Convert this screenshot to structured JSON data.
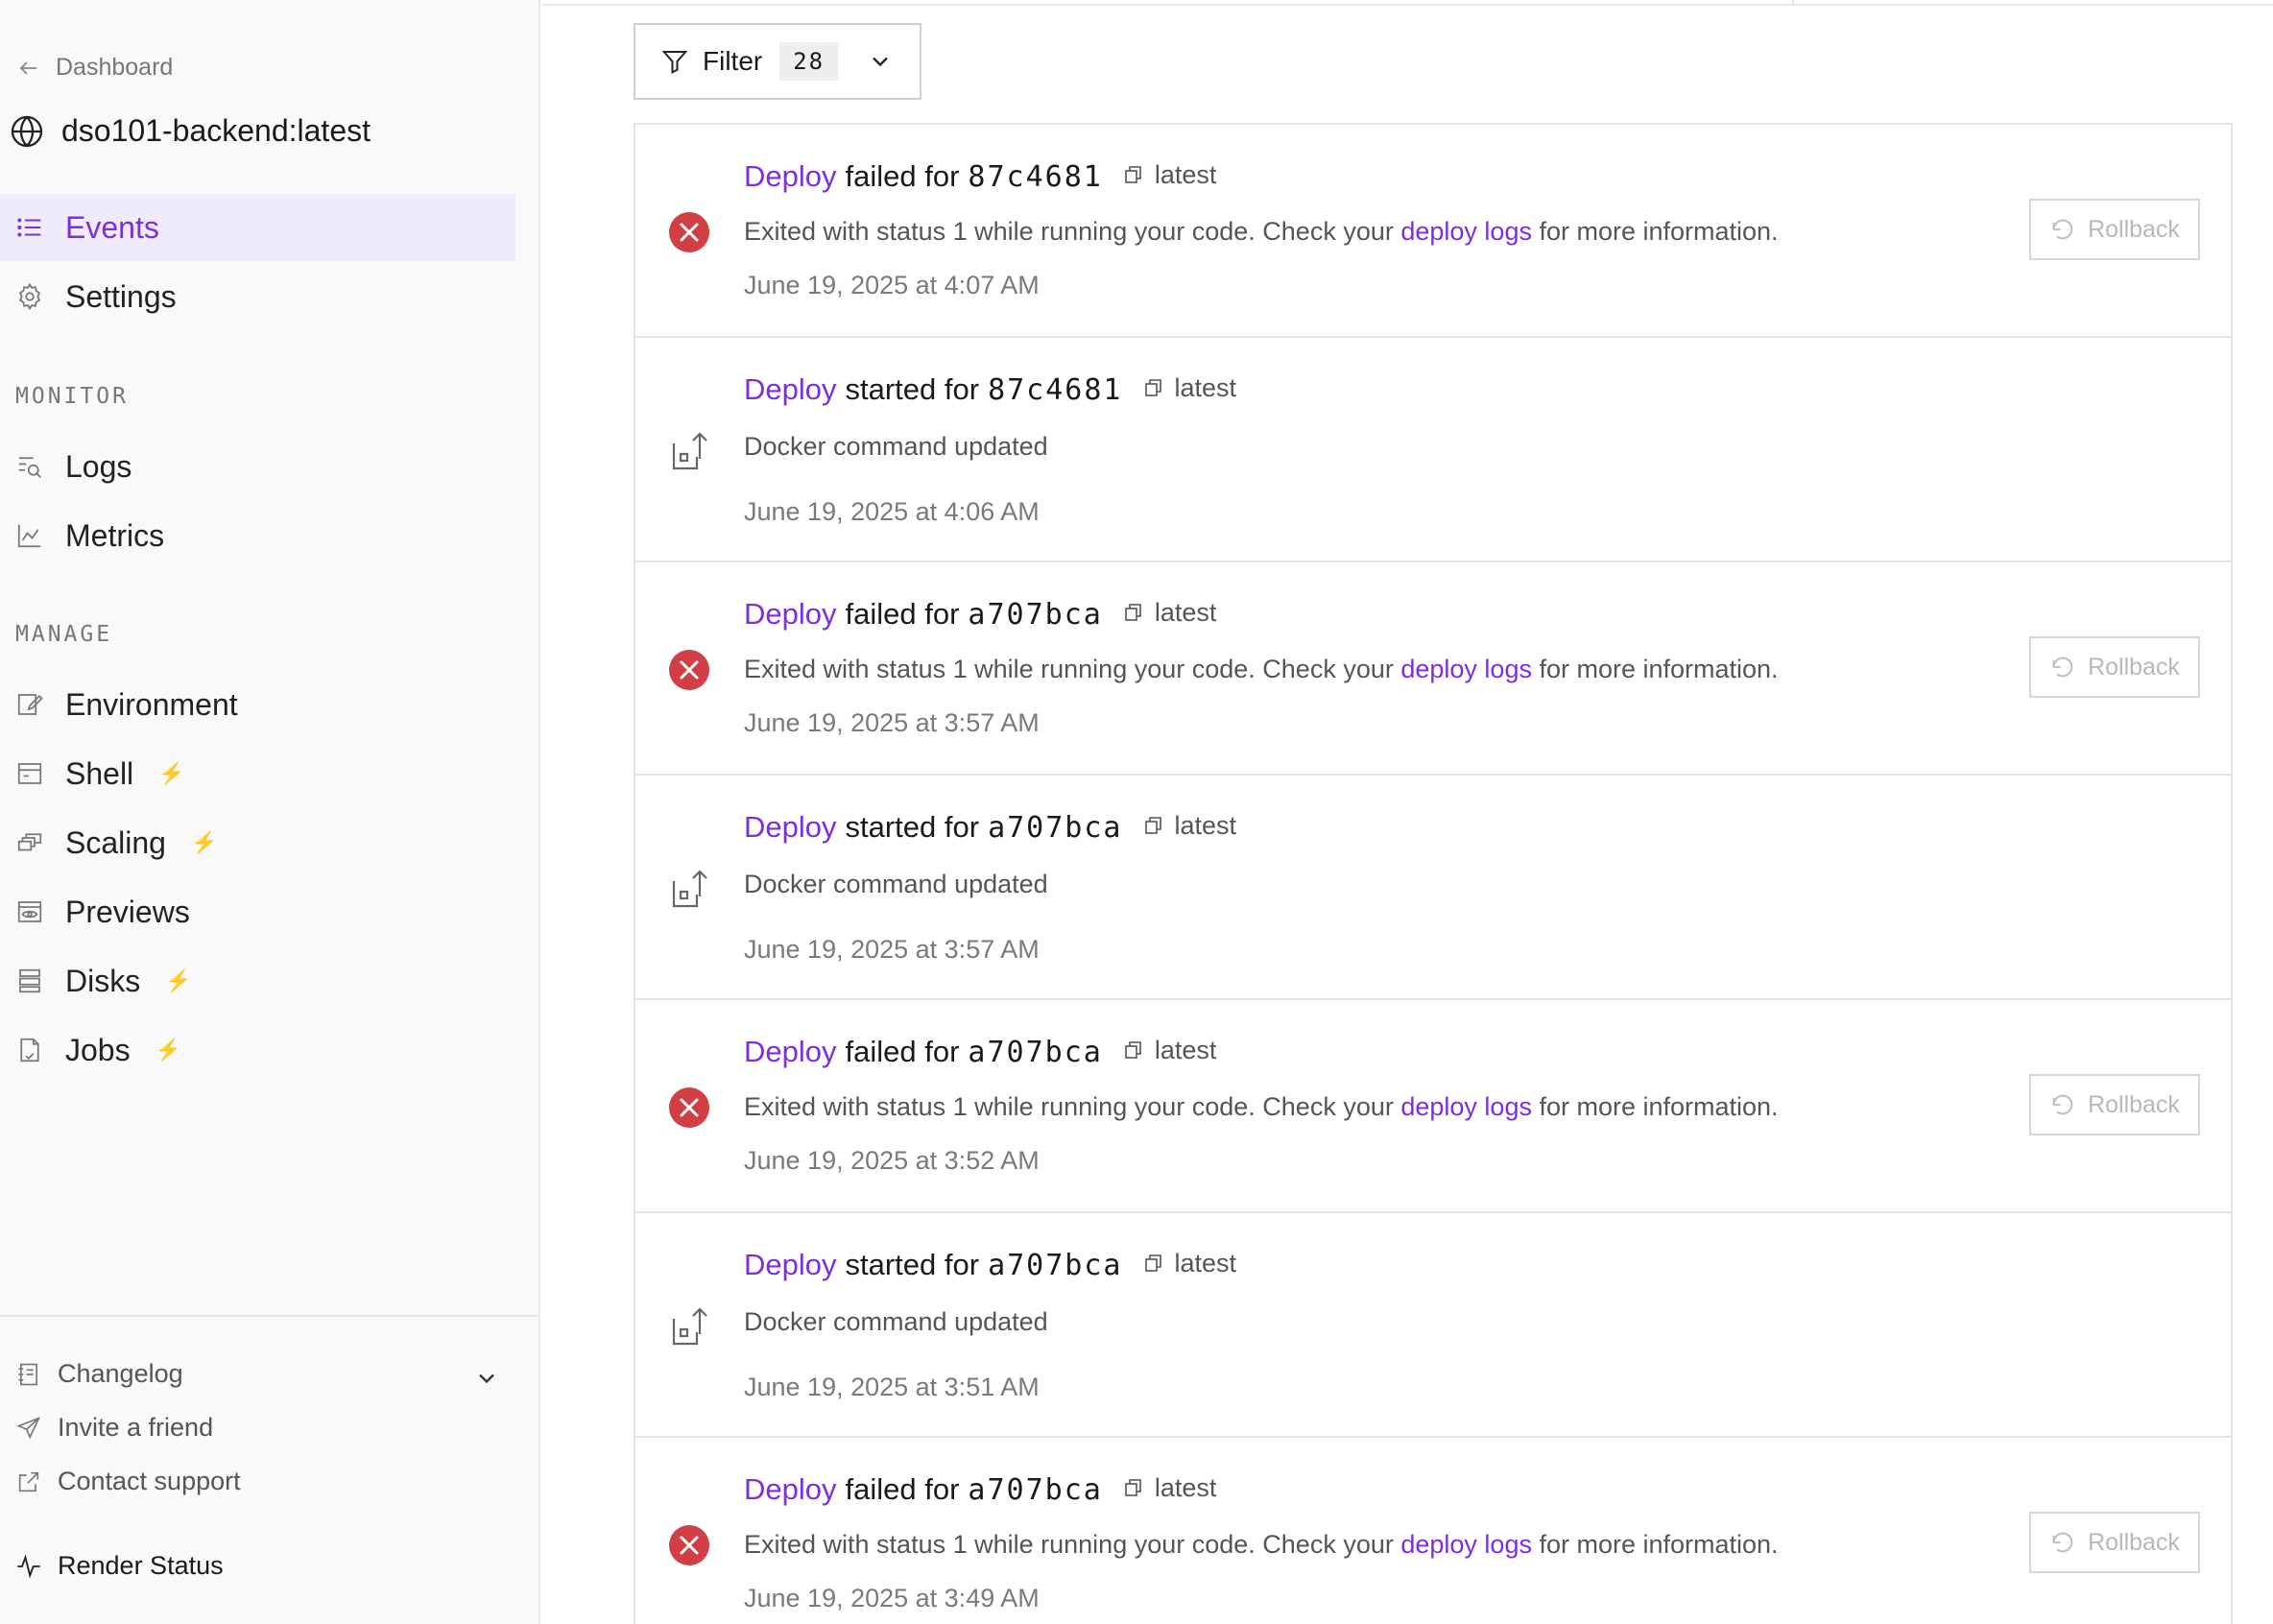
{
  "sidebar": {
    "back_label": "Dashboard",
    "service_name": "dso101-backend:latest",
    "nav": [
      {
        "label": "Events",
        "icon": "list-icon",
        "active": true
      },
      {
        "label": "Settings",
        "icon": "gear-icon"
      }
    ],
    "monitor_label": "MONITOR",
    "monitor": [
      {
        "label": "Logs",
        "icon": "logs-search-icon"
      },
      {
        "label": "Metrics",
        "icon": "chart-line-icon"
      }
    ],
    "manage_label": "MANAGE",
    "manage": [
      {
        "label": "Environment",
        "icon": "edit-icon"
      },
      {
        "label": "Shell",
        "icon": "terminal-icon",
        "bolt": "⚡"
      },
      {
        "label": "Scaling",
        "icon": "scaling-icon",
        "bolt": "⚡"
      },
      {
        "label": "Previews",
        "icon": "eye-icon"
      },
      {
        "label": "Disks",
        "icon": "disk-icon",
        "bolt": "⚡"
      },
      {
        "label": "Jobs",
        "icon": "file-icon",
        "bolt": "⚡"
      }
    ],
    "footer": {
      "changelog": "Changelog",
      "invite": "Invite a friend",
      "support": "Contact support",
      "status": "Render Status"
    }
  },
  "filter": {
    "label": "Filter",
    "count": "28"
  },
  "events": [
    {
      "type": "failed",
      "link": "Deploy",
      "verb": "failed for",
      "commit": "87c4681",
      "tag": "latest",
      "desc_pre": "Exited with status 1 while running your code. Check your ",
      "desc_link": "deploy logs",
      "desc_post": " for more information.",
      "time": "June 19, 2025 at 4:07 AM",
      "rollback": "Rollback"
    },
    {
      "type": "started",
      "link": "Deploy",
      "verb": "started for",
      "commit": "87c4681",
      "tag": "latest",
      "desc": "Docker command updated",
      "time": "June 19, 2025 at 4:06 AM"
    },
    {
      "type": "failed",
      "link": "Deploy",
      "verb": "failed for",
      "commit": "a707bca",
      "tag": "latest",
      "desc_pre": "Exited with status 1 while running your code. Check your ",
      "desc_link": "deploy logs",
      "desc_post": " for more information.",
      "time": "June 19, 2025 at 3:57 AM",
      "rollback": "Rollback"
    },
    {
      "type": "started",
      "link": "Deploy",
      "verb": "started for",
      "commit": "a707bca",
      "tag": "latest",
      "desc": "Docker command updated",
      "time": "June 19, 2025 at 3:57 AM"
    },
    {
      "type": "failed",
      "link": "Deploy",
      "verb": "failed for",
      "commit": "a707bca",
      "tag": "latest",
      "desc_pre": "Exited with status 1 while running your code. Check your ",
      "desc_link": "deploy logs",
      "desc_post": " for more information.",
      "time": "June 19, 2025 at 3:52 AM",
      "rollback": "Rollback"
    },
    {
      "type": "started",
      "link": "Deploy",
      "verb": "started for",
      "commit": "a707bca",
      "tag": "latest",
      "desc": "Docker command updated",
      "time": "June 19, 2025 at 3:51 AM"
    },
    {
      "type": "failed",
      "link": "Deploy",
      "verb": "failed for",
      "commit": "a707bca",
      "tag": "latest",
      "desc_pre": "Exited with status 1 while running your code. Check your ",
      "desc_link": "deploy logs",
      "desc_post": " for more information.",
      "time": "June 19, 2025 at 3:49 AM",
      "rollback": "Rollback"
    }
  ],
  "colors": {
    "accent": "#7c2fe0",
    "error": "#d13f45",
    "bolt": "#d32be8",
    "active_bg": "#efebfb"
  }
}
